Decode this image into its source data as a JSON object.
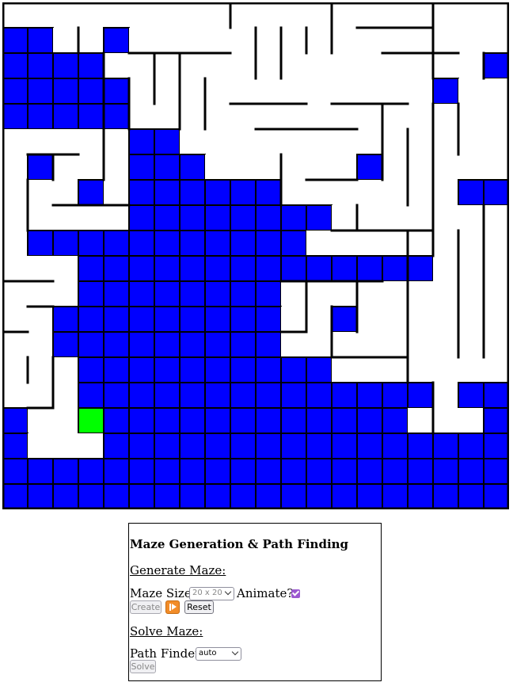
{
  "maze": {
    "rows": 20,
    "cols": 20,
    "colors": {
      "visited": "#0000ff",
      "current": "#00ff00",
      "open": "#ffffff",
      "wall": "#000000"
    },
    "cells": [
      "....................",
      "VV..V...............",
      "VVVV...............V",
      "VVVVV............V..",
      "VVVVV...............",
      ".....VV.............",
      ".V...VVV......V.....",
      "...V.VVVVVV.......VV",
      ".....VVVVVVVV.......",
      ".VVVVVVVVVVV........",
      "...VVVVVVVVVVVVVV...",
      "...VVVVVVVV.........",
      "..VVVVVVVVV..V......",
      "..VVVVVVVVV.........",
      "...VVVVVVVVVV.......",
      "...VVVVVVVVVVVVVV.VV",
      "V..GVVVVVVVVVVVV...V",
      "V...VVVVVVVVVVVVVVVV",
      "VVVVVVVVVVVVVVVVVVVV",
      "VVVVVVVVVVVVVVVVVVVV"
    ]
  },
  "controls": {
    "title": "Maze Generation & Path Finding",
    "generate_heading": "Generate Maze:",
    "maze_size_label": "Maze Size:",
    "maze_size_value": "20 x 20",
    "animate_label": "Animate?",
    "animate_checked": true,
    "create_label": "Create",
    "reset_label": "Reset",
    "solve_heading": "Solve Maze:",
    "path_finder_label": "Path Finder:",
    "path_finder_value": "auto",
    "solve_label": "Solve",
    "play_icon": "play-step-icon"
  }
}
